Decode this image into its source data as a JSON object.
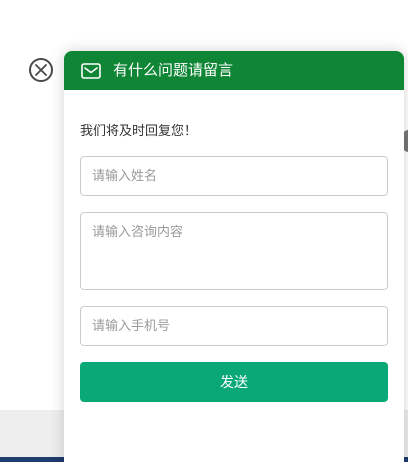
{
  "header": {
    "title": "有什么问题请留言"
  },
  "form": {
    "subtitle": "我们将及时回复您！",
    "name_placeholder": "请输入姓名",
    "content_placeholder": "请输入咨询内容",
    "phone_placeholder": "请输入手机号",
    "send_label": "发送"
  },
  "icons": {
    "close": "close-icon",
    "mail": "mail-icon"
  },
  "colors": {
    "header_bg": "#0f8635",
    "button_bg": "#0aa876",
    "bottom_bar": "#1f3c6e"
  }
}
